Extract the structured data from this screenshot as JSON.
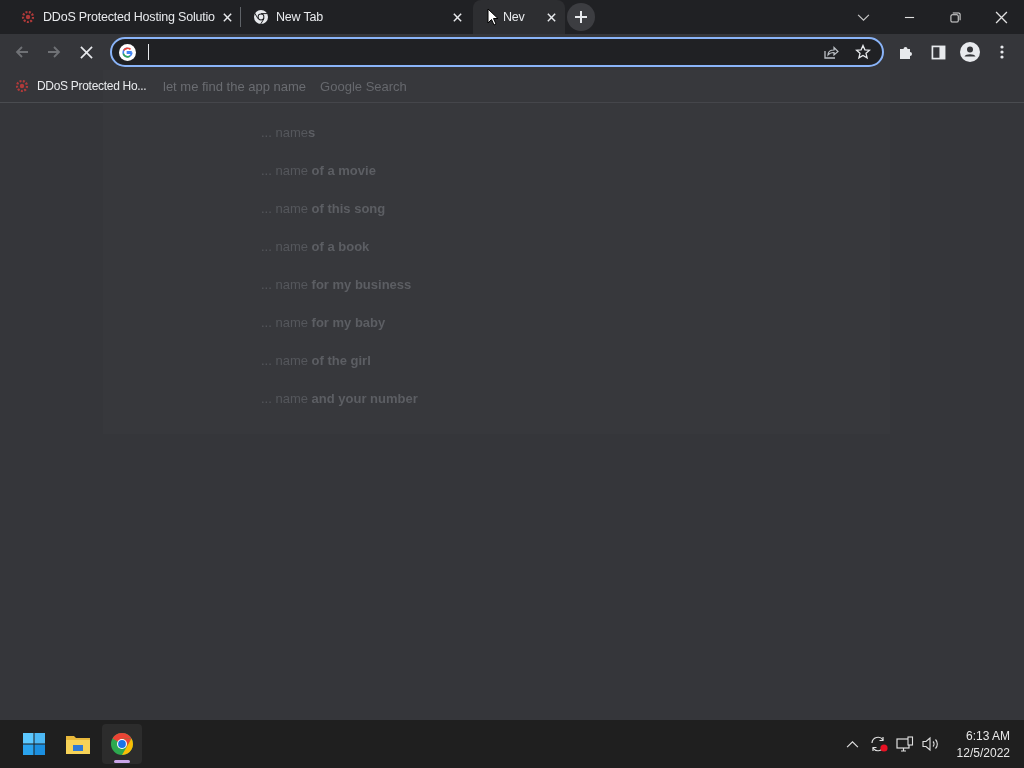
{
  "tabs": [
    {
      "title": "DDoS Protected Hosting Solutio",
      "kind": "site",
      "selected": false
    },
    {
      "title": "New Tab",
      "kind": "chrome",
      "selected": false
    },
    {
      "title": "Nev",
      "kind": "blank",
      "selected": true
    }
  ],
  "toolbar": {
    "loading": true
  },
  "bookmarks": [
    {
      "label": "DDoS Protected Ho..."
    }
  ],
  "omnibox_dropdown": {
    "query": "let me find the app name",
    "hint": "Google Search",
    "suggestions": [
      "... name**s**",
      "... name **of a movie**",
      "... name **of this song**",
      "... name **of a book**",
      "... name **for my business**",
      "... name **for my baby**",
      "... name **of the girl**",
      "... name **and your number**"
    ]
  },
  "taskbar": {
    "apps": [
      {
        "kind": "start",
        "selected": false
      },
      {
        "kind": "files",
        "selected": false
      },
      {
        "kind": "chrome",
        "selected": true
      }
    ],
    "time": "6:13 AM",
    "date": "12/5/2022"
  }
}
